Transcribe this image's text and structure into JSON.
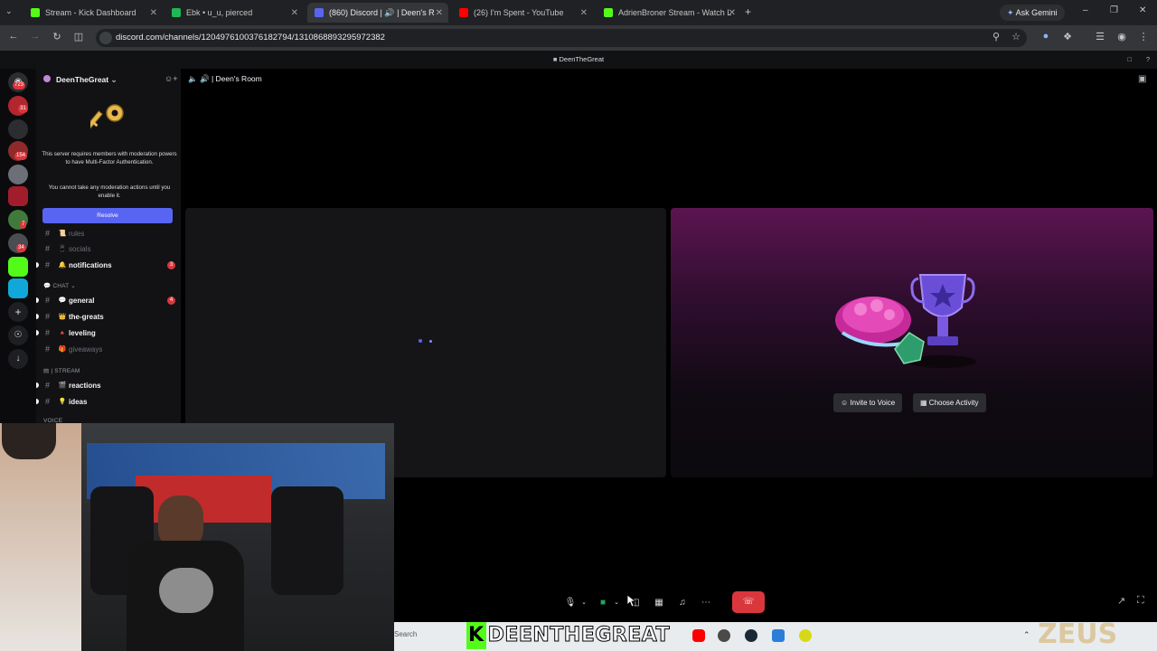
{
  "browser": {
    "tabs": [
      {
        "label": "Stream - Kick Dashboard",
        "color": "#53fc18"
      },
      {
        "label": "Ebk • u_u, pierced",
        "color": "#1db954"
      },
      {
        "label": "(860) Discord | 🔊 | Deen's R",
        "color": "#5865f2",
        "active": true
      },
      {
        "label": "(26) I'm Spent - YouTube",
        "color": "#ff0000"
      },
      {
        "label": "AdrienBroner Stream - Watch L",
        "color": "#53fc18"
      }
    ],
    "ask_gemini": "Ask Gemini",
    "url": "discord.com/channels/1204976100376182794/1310868893295972382"
  },
  "discord": {
    "title": "DeenTheGreat",
    "server_badges": [
      "723",
      "31",
      "154",
      "7",
      "34"
    ],
    "guild_name": "DeenTheGreat",
    "mfa_notice": "This server requires members with moderation powers to have Multi-Factor Authentication.",
    "mfa_warning": "You cannot take any moderation actions until you enable it.",
    "resolve_label": "Resolve",
    "channels_top": [
      {
        "name": "rules",
        "emoji": "📜",
        "muted": true
      },
      {
        "name": "socials",
        "emoji": "📱",
        "muted": true
      },
      {
        "name": "notifications",
        "emoji": "🔔",
        "muted": false,
        "count": "3"
      }
    ],
    "category_chat": "CHAT",
    "channels_chat": [
      {
        "name": "general",
        "emoji": "💬",
        "count": "4"
      },
      {
        "name": "the-greats",
        "emoji": "👑"
      },
      {
        "name": "leveling",
        "emoji": "🔺"
      },
      {
        "name": "giveaways",
        "emoji": "🎁",
        "muted": true
      }
    ],
    "category_stream": "| STREAM",
    "channels_stream": [
      {
        "name": "reactions",
        "emoji": "🎬"
      },
      {
        "name": "ideas",
        "emoji": "💡"
      }
    ],
    "category_voice": "VOICE",
    "voice_channel": "| Deen's Room",
    "invite_label": "Invite to Voice",
    "activity_label": "Choose Activity"
  },
  "taskbar": {
    "search": "Search",
    "streamer_name": "DEENTHEGREAT",
    "watermark": "ZEUS"
  }
}
